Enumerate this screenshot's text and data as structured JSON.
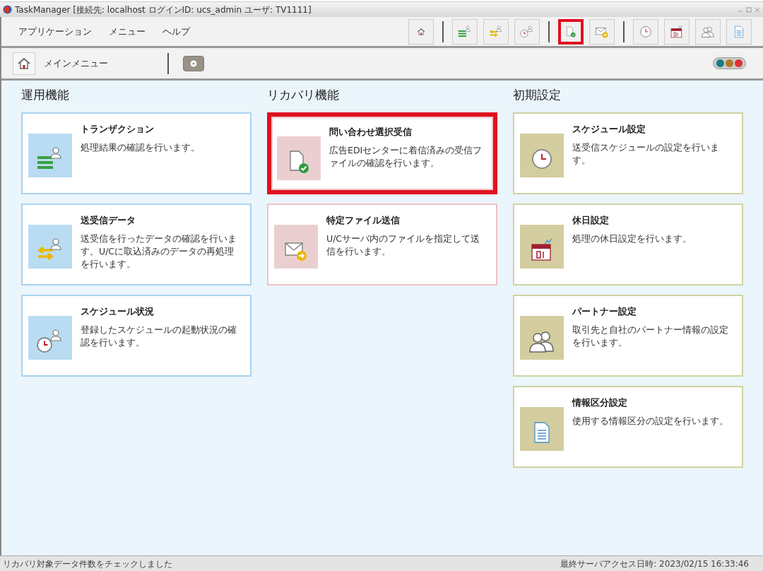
{
  "window": {
    "title": "TaskManager [接続先: localhost  ログインID: ucs_admin  ユーザ: TV1111]"
  },
  "menu": [
    "アプリケーション",
    "メニュー",
    "ヘルプ"
  ],
  "toolbar": {
    "groups": [
      [
        {
          "kind": "home",
          "highlighted": false
        }
      ],
      [
        {
          "kind": "transaction",
          "highlighted": false
        },
        {
          "kind": "data",
          "highlighted": false
        },
        {
          "kind": "schedule-status",
          "highlighted": false
        }
      ],
      [
        {
          "kind": "inquiry",
          "highlighted": true
        },
        {
          "kind": "send-file",
          "highlighted": false
        }
      ],
      [
        {
          "kind": "clock",
          "highlighted": false
        },
        {
          "kind": "holiday",
          "highlighted": false
        },
        {
          "kind": "partner",
          "highlighted": false
        },
        {
          "kind": "info-class",
          "highlighted": false
        }
      ]
    ]
  },
  "nav": {
    "label": "メインメニュー",
    "status_dots": [
      {
        "color": "#1f7a80"
      },
      {
        "color": "#b07a2a"
      },
      {
        "color": "#e0303a"
      }
    ]
  },
  "sections": [
    {
      "title": "運用機能",
      "kind": "blue",
      "cards": [
        {
          "kind": "transaction",
          "title": "トランザクション",
          "description": "処理結果の確認を行います。",
          "highlighted": false
        },
        {
          "kind": "data",
          "title": "送受信データ",
          "description": "送受信を行ったデータの確認を行います。U/Cに取込済みのデータの再処理を行います。",
          "highlighted": false
        },
        {
          "kind": "schedule-status",
          "title": "スケジュール状況",
          "description": "登録したスケジュールの起動状況の確認を行います。",
          "highlighted": false
        }
      ]
    },
    {
      "title": "リカバリ機能",
      "kind": "pink",
      "cards": [
        {
          "kind": "inquiry",
          "title": "問い合わせ選択受信",
          "description": "広告EDIセンターに着信済みの受信ファイルの確認を行います。",
          "highlighted": true
        },
        {
          "kind": "send-file",
          "title": "特定ファイル送信",
          "description": "U/Cサーバ内のファイルを指定して送信を行います。",
          "highlighted": false
        }
      ]
    },
    {
      "title": "初期設定",
      "kind": "olive",
      "cards": [
        {
          "kind": "clock",
          "title": "スケジュール設定",
          "description": "送受信スケジュールの設定を行います。",
          "highlighted": false
        },
        {
          "kind": "holiday",
          "title": "休日設定",
          "description": "処理の休日設定を行います。",
          "highlighted": false
        },
        {
          "kind": "partner",
          "title": "パートナー設定",
          "description": "取引先と自社のパートナー情報の設定を行います。",
          "highlighted": false
        },
        {
          "kind": "info-class",
          "title": "情報区分設定",
          "description": "使用する情報区分の設定を行います。",
          "highlighted": false
        }
      ]
    }
  ],
  "status_bar": {
    "message": "リカバリ対象データ件数をチェックしました",
    "last_access": "最終サーバアクセス日時: 2023/02/15 16:33:46"
  }
}
